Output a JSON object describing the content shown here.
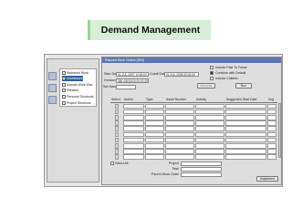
{
  "slide": {
    "title": "Demand Management"
  },
  "navigator": {
    "tree": [
      {
        "label": "Released Work"
      },
      {
        "label": "Unreleased",
        "selected": true
      },
      {
        "label": "Actuals Work Wav"
      },
      {
        "label": "Rebates"
      },
      {
        "label": "Personal Shortcuts"
      },
      {
        "label": "Project Shortcuts"
      }
    ]
  },
  "planned_work_orders": {
    "title": "Planned Work Orders (RNI)",
    "start_date_label": "Start Date",
    "start_date_value": "01-JUL-2007 12:00:00",
    "cutoff_date_label": "Cutoff Date",
    "cutoff_date_value": "01-JUL-2008 00:00:00",
    "horizon_label": "Horizon",
    "horizon_value": "365 (08/01/00 00:00 00:01)",
    "set_name_label": "Set Name",
    "include_past_label": "Include Past To Future",
    "combine_default_label": "Combine with Default",
    "include_children_label": "Include Children",
    "simulate_button": "Simulate",
    "run_button": "Run",
    "columns": [
      "Select",
      "Action",
      "Type",
      "Asset Number",
      "Activity",
      "Suggested Start Date",
      "Sug"
    ],
    "row_count": 10,
    "select_all_label": "Select All",
    "project_label": "Project",
    "task_label": "Task",
    "parent_work_order_label": "Parent Work Order",
    "implement_button": "Implement"
  }
}
